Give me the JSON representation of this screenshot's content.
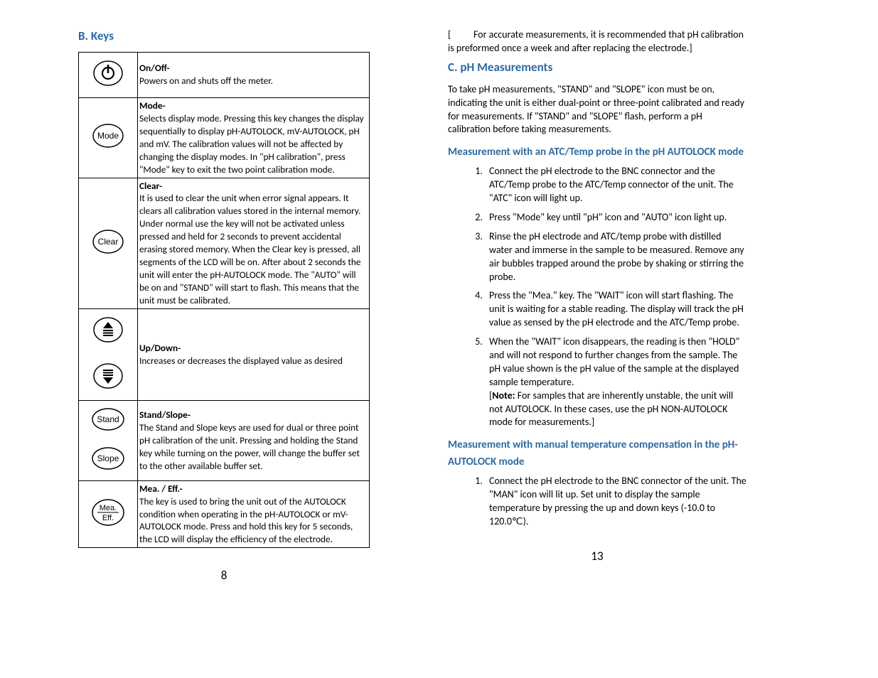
{
  "left": {
    "heading": "B. Keys",
    "rows": [
      {
        "icon": "power",
        "title": "On/Off-",
        "desc": "Powers on and shuts off the meter."
      },
      {
        "icon": "mode",
        "title": "Mode-",
        "desc": "Selects display mode. Pressing this key changes the display sequentially to display pH-AUTOLOCK, mV-AUTOLOCK, pH and mV. The calibration values will not be affected by changing the display modes. In \"pH calibration\", press \"Mode\" key to exit the two point calibration mode."
      },
      {
        "icon": "clear",
        "title": "Clear-",
        "desc": "It is used to clear the unit when error signal appears. It clears all calibration values stored in the internal memory. Under normal use the key will not be activated unless pressed and held for 2 seconds to prevent accidental erasing stored memory. When the Clear key is pressed, all segments of the LCD will be on. After about 2 seconds the unit will enter the pH-AUTOLOCK mode. The \"AUTO\" will be on and \"STAND\" will start to flash. This means that the unit must be calibrated."
      },
      {
        "icon": "updown",
        "title": "Up/Down-",
        "desc": "Increases or decreases the displayed value as desired"
      },
      {
        "icon": "standslope",
        "title": "Stand/Slope-",
        "desc": "The Stand and Slope keys are used for dual or three point pH calibration of the unit. Pressing and holding the Stand key while turning on the power, will change the buffer set to the other available buffer set."
      },
      {
        "icon": "meaeff",
        "title": "Mea. / Eff.-",
        "desc": "The key is used to bring the unit out of the AUTOLOCK condition when operating in the pH-AUTOLOCK or mV-AUTOLOCK mode. Press and hold this key for 5 seconds, the LCD will display the efficiency of the electrode."
      }
    ],
    "pagenum": "8"
  },
  "right": {
    "top_note": "[          For accurate measurements, it is recommended that pH calibration is preformed once a week and after replacing the electrode.]",
    "heading": "C. pH Measurements",
    "intro": "To take pH measurements, \"STAND\" and \"SLOPE\" icon must be on, indicating the unit is either dual-point or three-point calibrated and ready for measurements. If \"STAND\" and \"SLOPE\" flash, perform a pH calibration before taking measurements.",
    "sub1": "Measurement with an ATC/Temp probe in the pH AUTOLOCK mode",
    "steps1": [
      "Connect the pH electrode to the BNC connector and the ATC/Temp probe to the ATC/Temp connector of the unit. The \"ATC\" icon will light up.",
      "Press \"Mode\" key until \"pH\" icon and \"AUTO\" icon light up.",
      "Rinse the pH electrode and ATC/temp probe with distilled water and immerse in the sample to be measured. Remove any air bubbles trapped around the probe by shaking or stirring the probe.",
      "Press the \"Mea.\" key. The \"WAIT\" icon will start flashing. The unit is waiting for a stable reading. The display will track the pH value as sensed by the pH electrode and the ATC/Temp probe.",
      "When the \"WAIT\" icon disappears, the reading is then \"HOLD\" and will not respond to further changes from the sample. The pH value shown is the pH value of the sample at the displayed sample temperature."
    ],
    "note_label": "Note:",
    "note_body": " For samples that are inherently unstable, the unit will not AUTOLOCK. In these cases, use the pH NON-AUTOLOCK mode for measurements.]",
    "note_open": "[",
    "sub2": "Measurement with manual temperature compensation in the pH-AUTOLOCK mode",
    "steps2": [
      "Connect the pH electrode to the BNC connector of the unit. The \"MAN\" icon will lit up. Set unit to display the sample temperature by pressing the up and down keys (-10.0 to 120.0℃)."
    ],
    "pagenum": "13"
  }
}
